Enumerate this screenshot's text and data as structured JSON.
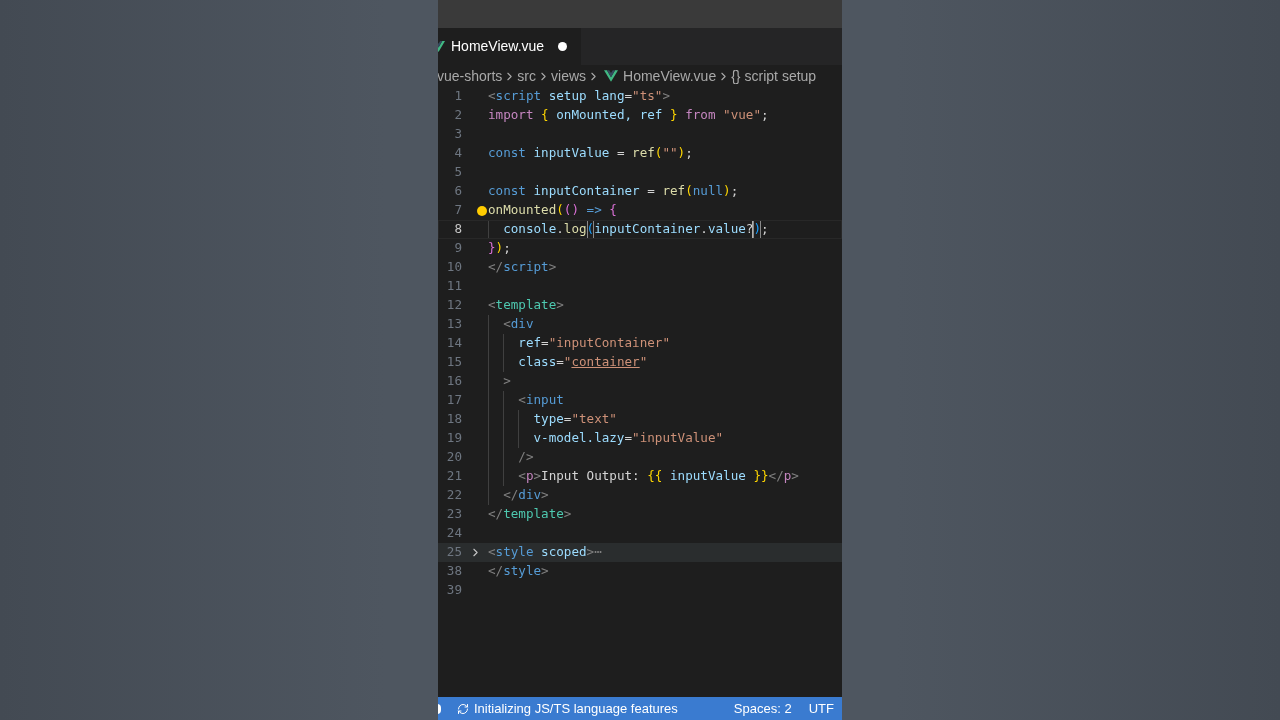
{
  "tab": {
    "label": "HomeView.vue",
    "selected": true,
    "modified": true
  },
  "breadcrumbs": [
    {
      "label": "vue-shorts",
      "kind": "folder"
    },
    {
      "label": "src",
      "kind": "folder"
    },
    {
      "label": "views",
      "kind": "folder"
    },
    {
      "label": "HomeView.vue",
      "kind": "vue-file"
    },
    {
      "label": "script setup",
      "kind": "symbol",
      "symbol": "{}"
    }
  ],
  "lines": [
    {
      "number": "1",
      "current": false,
      "folded": false,
      "tokens": [
        {
          "text": "<",
          "kind": "angle"
        },
        {
          "text": "script",
          "kind": "tag"
        },
        {
          "text": " setup lang",
          "kind": "attr"
        },
        {
          "text": "=",
          "kind": "punct"
        },
        {
          "text": "\"ts\"",
          "kind": "string"
        },
        {
          "text": ">",
          "kind": "angle"
        }
      ]
    },
    {
      "number": "2",
      "current": false,
      "folded": false,
      "tokens": [
        {
          "text": "import ",
          "kind": "keyword"
        },
        {
          "text": "{",
          "kind": "bracket1"
        },
        {
          "text": " onMounted, ref ",
          "kind": "var"
        },
        {
          "text": "}",
          "kind": "bracket1"
        },
        {
          "text": " from ",
          "kind": "keyword"
        },
        {
          "text": "\"vue\"",
          "kind": "string"
        },
        {
          "text": ";",
          "kind": "punct"
        }
      ]
    },
    {
      "number": "3",
      "current": false,
      "folded": false
    },
    {
      "number": "4",
      "current": false,
      "folded": false,
      "tokens": [
        {
          "text": "const ",
          "kind": "storage"
        },
        {
          "text": "inputValue",
          "kind": "var"
        },
        {
          "text": " = ",
          "kind": "punct"
        },
        {
          "text": "ref",
          "kind": "func"
        },
        {
          "text": "(",
          "kind": "bracket1"
        },
        {
          "text": "\"\"",
          "kind": "string"
        },
        {
          "text": ")",
          "kind": "bracket1"
        },
        {
          "text": ";",
          "kind": "punct"
        }
      ]
    },
    {
      "number": "5",
      "current": false,
      "folded": false
    },
    {
      "number": "6",
      "current": false,
      "folded": false,
      "tokens": [
        {
          "text": "const ",
          "kind": "storage"
        },
        {
          "text": "inputContainer",
          "kind": "var"
        },
        {
          "text": " = ",
          "kind": "punct"
        },
        {
          "text": "ref",
          "kind": "func"
        },
        {
          "text": "(",
          "kind": "bracket1"
        },
        {
          "text": "null",
          "kind": "storage"
        },
        {
          "text": ")",
          "kind": "bracket1"
        },
        {
          "text": ";",
          "kind": "punct"
        }
      ]
    },
    {
      "number": "7",
      "current": false,
      "folded": false,
      "lightbulb": true,
      "tokens": [
        {
          "text": "onMounted",
          "kind": "func"
        },
        {
          "text": "(",
          "kind": "bracket1"
        },
        {
          "text": "()",
          "kind": "bracket2"
        },
        {
          "text": " => ",
          "kind": "storage"
        },
        {
          "text": "{",
          "kind": "bracket2"
        }
      ]
    },
    {
      "number": "8",
      "current": true,
      "folded": false,
      "tokens": [
        {
          "kind": "indent"
        },
        {
          "text": "console",
          "kind": "var"
        },
        {
          "text": ".",
          "kind": "punct"
        },
        {
          "text": "log",
          "kind": "func"
        },
        {
          "text": "(",
          "kind": "bracket3",
          "matched": true
        },
        {
          "text": "inputContainer",
          "kind": "var"
        },
        {
          "text": ".",
          "kind": "punct"
        },
        {
          "text": "value",
          "kind": "var"
        },
        {
          "text": "?",
          "kind": "punct"
        },
        {
          "kind": "cursor"
        },
        {
          "text": ")",
          "kind": "bracket3",
          "matched": true
        },
        {
          "text": ";",
          "kind": "punct"
        }
      ]
    },
    {
      "number": "9",
      "current": false,
      "folded": false,
      "tokens": [
        {
          "text": "}",
          "kind": "bracket2"
        },
        {
          "text": ")",
          "kind": "bracket1"
        },
        {
          "text": ";",
          "kind": "punct"
        }
      ]
    },
    {
      "number": "10",
      "current": false,
      "folded": false,
      "tokens": [
        {
          "text": "</",
          "kind": "angle"
        },
        {
          "text": "script",
          "kind": "tag"
        },
        {
          "text": ">",
          "kind": "angle"
        }
      ]
    },
    {
      "number": "11",
      "current": false,
      "folded": false
    },
    {
      "number": "12",
      "current": false,
      "folded": false,
      "tokens": [
        {
          "text": "<",
          "kind": "angle"
        },
        {
          "text": "template",
          "kind": "tagc"
        },
        {
          "text": ">",
          "kind": "angle"
        }
      ]
    },
    {
      "number": "13",
      "current": false,
      "folded": false,
      "tokens": [
        {
          "kind": "indent"
        },
        {
          "text": "<",
          "kind": "angle"
        },
        {
          "text": "div",
          "kind": "tag"
        }
      ]
    },
    {
      "number": "14",
      "current": false,
      "folded": false,
      "tokens": [
        {
          "kind": "indent"
        },
        {
          "kind": "indent"
        },
        {
          "text": "ref",
          "kind": "attr"
        },
        {
          "text": "=",
          "kind": "punct"
        },
        {
          "text": "\"inputContainer\"",
          "kind": "string"
        }
      ]
    },
    {
      "number": "15",
      "current": false,
      "folded": false,
      "tokens": [
        {
          "kind": "indent"
        },
        {
          "kind": "indent"
        },
        {
          "text": "class",
          "kind": "attr"
        },
        {
          "text": "=",
          "kind": "punct"
        },
        {
          "text": "\"",
          "kind": "string"
        },
        {
          "text": "container",
          "kind": "link"
        },
        {
          "text": "\"",
          "kind": "string"
        }
      ]
    },
    {
      "number": "16",
      "current": false,
      "folded": false,
      "tokens": [
        {
          "kind": "indent"
        },
        {
          "text": ">",
          "kind": "angle"
        }
      ]
    },
    {
      "number": "17",
      "current": false,
      "folded": false,
      "tokens": [
        {
          "kind": "indent"
        },
        {
          "kind": "indent"
        },
        {
          "text": "<",
          "kind": "angle"
        },
        {
          "text": "input",
          "kind": "tag"
        }
      ]
    },
    {
      "number": "18",
      "current": false,
      "folded": false,
      "tokens": [
        {
          "kind": "indent"
        },
        {
          "kind": "indent"
        },
        {
          "kind": "indent"
        },
        {
          "text": "type",
          "kind": "attr"
        },
        {
          "text": "=",
          "kind": "punct"
        },
        {
          "text": "\"text\"",
          "kind": "string"
        }
      ]
    },
    {
      "number": "19",
      "current": false,
      "folded": false,
      "tokens": [
        {
          "kind": "indent"
        },
        {
          "kind": "indent"
        },
        {
          "kind": "indent"
        },
        {
          "text": "v-model.lazy",
          "kind": "attr"
        },
        {
          "text": "=",
          "kind": "punct"
        },
        {
          "text": "\"inputValue\"",
          "kind": "string"
        }
      ]
    },
    {
      "number": "20",
      "current": false,
      "folded": false,
      "tokens": [
        {
          "kind": "indent"
        },
        {
          "kind": "indent"
        },
        {
          "text": "/>",
          "kind": "angle"
        }
      ]
    },
    {
      "number": "21",
      "current": false,
      "folded": false,
      "tokens": [
        {
          "kind": "indent"
        },
        {
          "kind": "indent"
        },
        {
          "text": "<",
          "kind": "angle"
        },
        {
          "text": "p",
          "kind": "tagp"
        },
        {
          "text": ">",
          "kind": "angle"
        },
        {
          "text": "Input Output: ",
          "kind": "punct"
        },
        {
          "text": "{{",
          "kind": "bracket1"
        },
        {
          "text": " inputValue ",
          "kind": "var"
        },
        {
          "text": "}}",
          "kind": "bracket1"
        },
        {
          "text": "</",
          "kind": "angle"
        },
        {
          "text": "p",
          "kind": "tagp"
        },
        {
          "text": ">",
          "kind": "angle"
        }
      ]
    },
    {
      "number": "22",
      "current": false,
      "folded": false,
      "tokens": [
        {
          "kind": "indent"
        },
        {
          "text": "</",
          "kind": "angle"
        },
        {
          "text": "div",
          "kind": "tag"
        },
        {
          "text": ">",
          "kind": "angle"
        }
      ]
    },
    {
      "number": "23",
      "current": false,
      "folded": false,
      "tokens": [
        {
          "text": "</",
          "kind": "angle"
        },
        {
          "text": "template",
          "kind": "tagc"
        },
        {
          "text": ">",
          "kind": "angle"
        }
      ]
    },
    {
      "number": "24",
      "current": false,
      "folded": false
    },
    {
      "number": "25",
      "current": false,
      "folded": true,
      "tokens": [
        {
          "text": "<",
          "kind": "angle"
        },
        {
          "text": "style",
          "kind": "tag"
        },
        {
          "text": " scoped",
          "kind": "attr"
        },
        {
          "text": ">",
          "kind": "angle"
        },
        {
          "text": "⋯",
          "kind": "fold-ellipsis"
        }
      ]
    },
    {
      "number": "38",
      "current": false,
      "folded": false,
      "tokens": [
        {
          "text": "</",
          "kind": "angle"
        },
        {
          "text": "style",
          "kind": "tag"
        },
        {
          "text": ">",
          "kind": "angle"
        }
      ]
    },
    {
      "number": "39",
      "current": false,
      "folded": false
    }
  ],
  "status_bar": {
    "items": [
      {
        "label": "Initializing JS/TS language features",
        "kind": "progress"
      },
      {
        "label": "Spaces: 2",
        "kind": "text"
      },
      {
        "label": "UTF",
        "kind": "text"
      }
    ]
  }
}
